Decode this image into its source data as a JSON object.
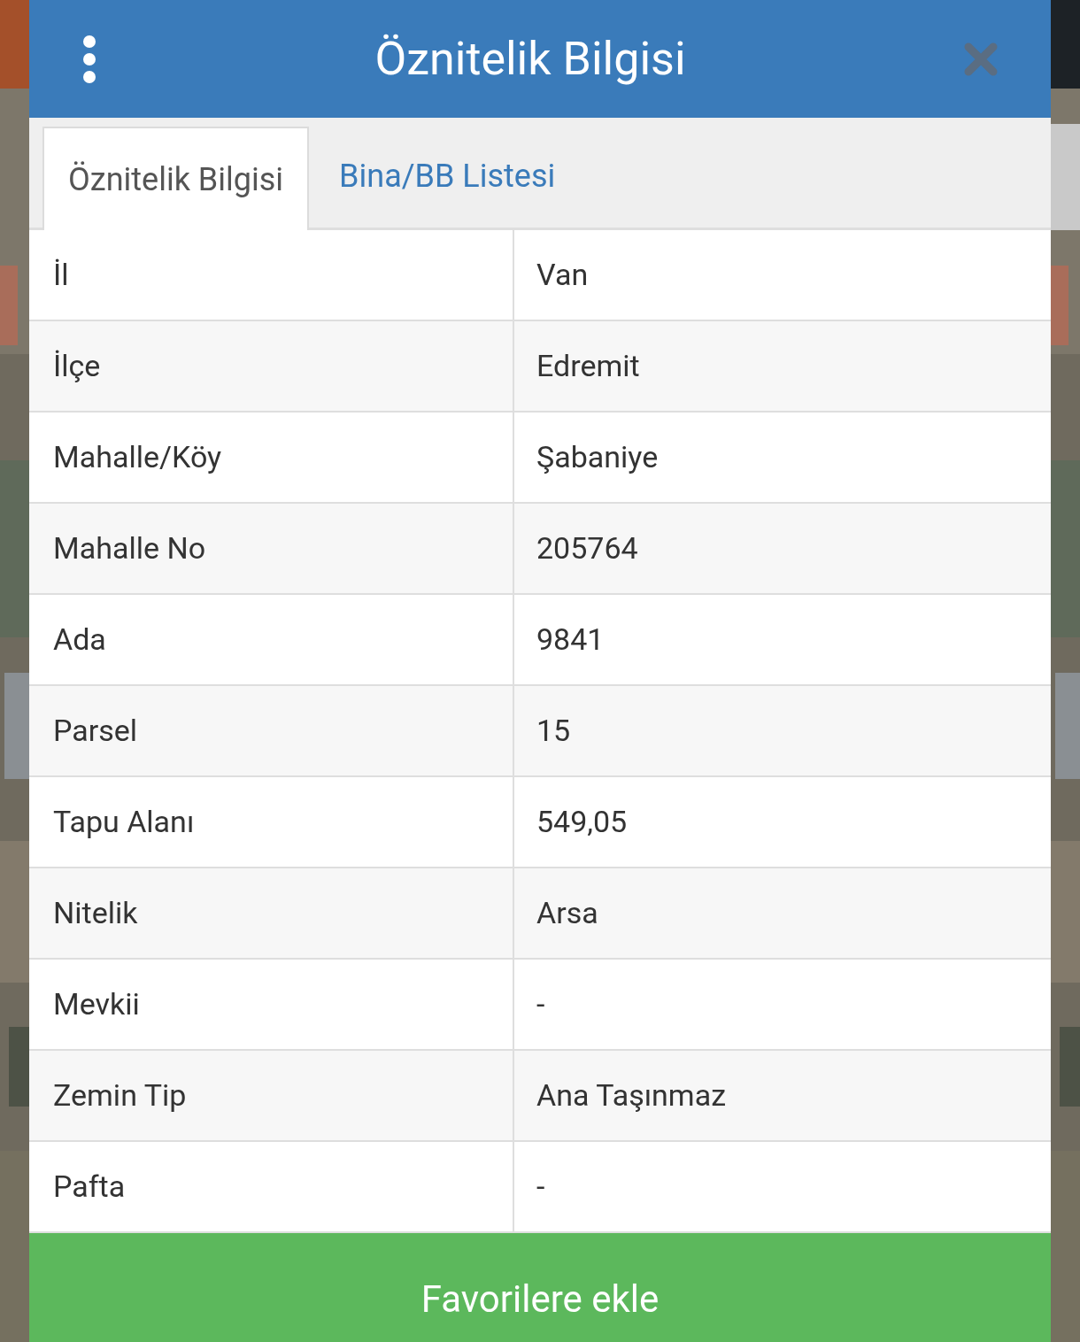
{
  "header": {
    "title": "Öznitelik Bilgisi"
  },
  "tabs": [
    {
      "label": "Öznitelik Bilgisi",
      "selected": true
    },
    {
      "label": "Bina/BB Listesi",
      "selected": false
    }
  ],
  "table": {
    "rows": [
      {
        "label": "İl",
        "value": "Van"
      },
      {
        "label": "İlçe",
        "value": "Edremit"
      },
      {
        "label": "Mahalle/Köy",
        "value": "Şabaniye"
      },
      {
        "label": "Mahalle No",
        "value": "205764"
      },
      {
        "label": "Ada",
        "value": "9841"
      },
      {
        "label": "Parsel",
        "value": "15"
      },
      {
        "label": "Tapu Alanı",
        "value": "549,05"
      },
      {
        "label": "Nitelik",
        "value": "Arsa"
      },
      {
        "label": "Mevkii",
        "value": "-"
      },
      {
        "label": "Zemin Tip",
        "value": "Ana Taşınmaz"
      },
      {
        "label": "Pafta",
        "value": "-"
      }
    ]
  },
  "button": {
    "label": "Favorilere ekle"
  }
}
